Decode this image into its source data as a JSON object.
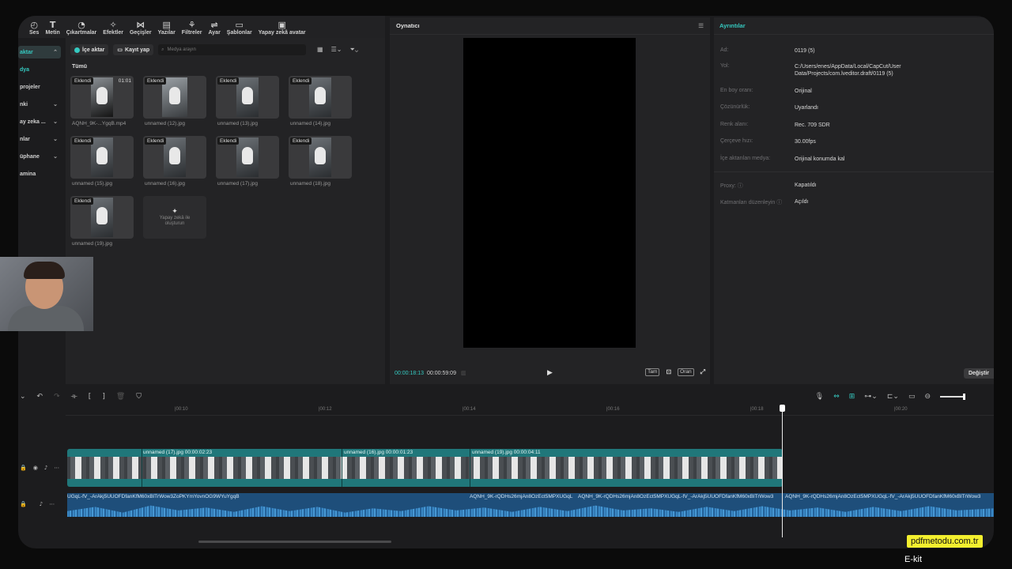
{
  "toolbar": [
    {
      "label": "Ses",
      "icon": "audio-icon"
    },
    {
      "label": "Metin",
      "icon": "text-icon"
    },
    {
      "label": "Çıkartmalar",
      "icon": "sticker-icon"
    },
    {
      "label": "Efektler",
      "icon": "effects-icon"
    },
    {
      "label": "Geçişler",
      "icon": "transitions-icon"
    },
    {
      "label": "Yazılar",
      "icon": "captions-icon"
    },
    {
      "label": "Filtreler",
      "icon": "filters-icon"
    },
    {
      "label": "Ayar",
      "icon": "adjust-icon"
    },
    {
      "label": "Şablonlar",
      "icon": "templates-icon"
    },
    {
      "label": "Yapay zekâ avatar",
      "icon": "avatar-icon"
    }
  ],
  "sidebar": {
    "items": [
      {
        "label": "aktar",
        "chevron": "⌃"
      },
      {
        "label": "dya",
        "chevron": ""
      },
      {
        "label": "projeler",
        "chevron": ""
      },
      {
        "label": "nki",
        "chevron": "⌄"
      },
      {
        "label": "ay zeka ...",
        "chevron": "⌄"
      },
      {
        "label": "nlar",
        "chevron": "⌄"
      },
      {
        "label": "üphane",
        "chevron": "⌄"
      },
      {
        "label": "amina",
        "chevron": ""
      }
    ]
  },
  "media": {
    "import_label": "İçe aktar",
    "record_label": "Kayıt yap",
    "search_placeholder": "Medya arayın",
    "section_label": "Tümü",
    "items": [
      {
        "badge": "Eklendi",
        "duration": "01:01",
        "name": "AQNH_9K-...YgqB.mp4"
      },
      {
        "badge": "Eklendi",
        "duration": "",
        "name": "unnamed (12).jpg"
      },
      {
        "badge": "Eklendi",
        "duration": "",
        "name": "unnamed (13).jpg"
      },
      {
        "badge": "Eklendi",
        "duration": "",
        "name": "unnamed (14).jpg"
      },
      {
        "badge": "Eklendi",
        "duration": "",
        "name": "unnamed (15).jpg"
      },
      {
        "badge": "Eklendi",
        "duration": "",
        "name": "unnamed (16).jpg"
      },
      {
        "badge": "Eklendi",
        "duration": "",
        "name": "unnamed (17).jpg"
      },
      {
        "badge": "Eklendi",
        "duration": "",
        "name": "unnamed (18).jpg"
      },
      {
        "badge": "Eklendi",
        "duration": "",
        "name": "unnamed (19).jpg"
      }
    ],
    "ai_create_label": "Yapay zekâ ile oluşturun"
  },
  "player": {
    "title": "Oynatıcı",
    "current_time": "00:00:18:13",
    "total_time": "00:00:59:09",
    "btn_full": "Tam",
    "btn_ratio": "Oran"
  },
  "details": {
    "title": "Ayrıntılar",
    "rows": [
      {
        "label": "Ad:",
        "value": "0119 (5)"
      },
      {
        "label": "Yol:",
        "value": "C:/Users/enes/AppData/Local/CapCut/User Data/Projects/com.lveditor.draft/0119 (5)"
      },
      {
        "label": "En boy oranı:",
        "value": "Orijinal"
      },
      {
        "label": "Çözünürlük:",
        "value": "Uyarlandı"
      },
      {
        "label": "Renk alanı:",
        "value": "Rec. 709 SDR"
      },
      {
        "label": "Çerçeve hızı:",
        "value": "30.00fps"
      },
      {
        "label": "İçe aktarılan medya:",
        "value": "Orijinal konumda kal"
      },
      {
        "label": "Proxy: ⓘ",
        "value": "Kapatıldı"
      },
      {
        "label": "Katmanları düzenleyin ⓘ",
        "value": "Açıldı"
      }
    ],
    "modify_label": "Değiştir"
  },
  "timeline": {
    "ruler": [
      "|00:10",
      "|00:12",
      "|00:14",
      "|00:16",
      "|00:18",
      "|00:20"
    ],
    "video_clips": [
      {
        "label": "unnamed (17).jpg  00:00:02:23"
      },
      {
        "label": "unnamed (16).jpg  00:00:01:23"
      },
      {
        "label": "unnamed (19).jpg  00:00:04:11"
      }
    ],
    "audio_clips": [
      {
        "label": "UGqL-fV_-ArAkj5UUOFDfanKfM60xBlTrWow3ZoPKYmYovnOG9WYuYgqB"
      },
      {
        "label": "AQNH_9K-rQDHs26mjAn8OzEct5MPXUGqL"
      },
      {
        "label": "AQNH_9K-rQDHs26mjAn8OzEct5MPXUGqL-fV_-ArAkj5UUOFDfanKfM60xBlTrWow3"
      },
      {
        "label": "AQNH_9K-rQDHs26mjAn8OzEct5MPXUGqL-fV_-ArAkj5UUOFDfanKfM60xBlTrWow3"
      }
    ]
  },
  "watermark": {
    "site": "pdfmetodu.com.tr",
    "caption": "E-kit"
  },
  "colors": {
    "accent": "#35c9c0",
    "video_track": "#20777a",
    "audio_track": "#1e4e7a"
  }
}
